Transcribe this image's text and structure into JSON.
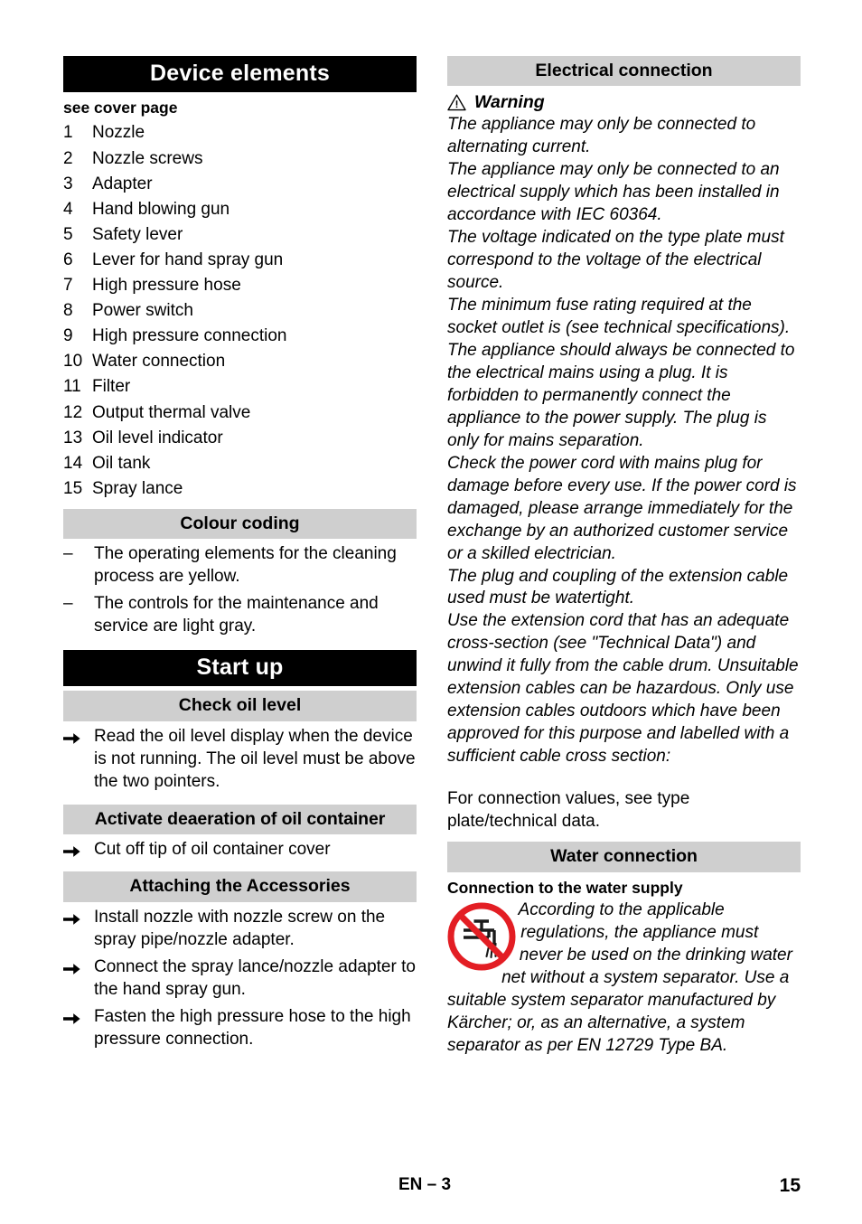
{
  "document": {
    "language_code": "EN",
    "footer_center": "EN – 3",
    "footer_page_number": "15"
  },
  "colors": {
    "heading_black_bg": "#000000",
    "heading_black_fg": "#ffffff",
    "heading_gray_bg": "#cfcfcf",
    "heading_gray_fg": "#000000",
    "prohibition_red": "#e31e24",
    "body_text": "#000000"
  },
  "left_column": {
    "device_elements": {
      "title": "Device elements",
      "lead": "see cover page",
      "items": [
        {
          "number": "1",
          "label": "Nozzle"
        },
        {
          "number": "2",
          "label": "Nozzle screws"
        },
        {
          "number": "3",
          "label": "Adapter"
        },
        {
          "number": "4",
          "label": "Hand blowing gun"
        },
        {
          "number": "5",
          "label": "Safety lever"
        },
        {
          "number": "6",
          "label": "Lever for hand spray gun"
        },
        {
          "number": "7",
          "label": "High pressure hose"
        },
        {
          "number": "8",
          "label": "Power switch"
        },
        {
          "number": "9",
          "label": "High pressure connection"
        },
        {
          "number": "10",
          "label": "Water connection"
        },
        {
          "number": "11",
          "label": "Filter"
        },
        {
          "number": "12",
          "label": "Output thermal valve"
        },
        {
          "number": "13",
          "label": "Oil level indicator"
        },
        {
          "number": "14",
          "label": "Oil tank"
        },
        {
          "number": "15",
          "label": "Spray lance"
        }
      ]
    },
    "colour_coding": {
      "title": "Colour coding",
      "bullet_mark": "–",
      "bullets": [
        "The operating elements for the cleaning process are yellow.",
        "The controls for the maintenance and service are light gray."
      ]
    },
    "start_up": {
      "title": "Start up"
    },
    "check_oil_level": {
      "title": "Check oil level",
      "steps": [
        "Read the oil level display when the device is not running. The oil level must be above the two pointers."
      ]
    },
    "activate_deaeration": {
      "title": "Activate deaeration of oil container",
      "steps": [
        "Cut off tip of oil container cover"
      ]
    },
    "attaching_accessories": {
      "title": "Attaching the Accessories",
      "steps": [
        "Install nozzle with nozzle screw on the spray pipe/nozzle adapter.",
        "Connect the spray lance/nozzle adapter to the hand spray gun.",
        "Fasten the high pressure hose to the high pressure connection."
      ]
    }
  },
  "right_column": {
    "electrical_connection": {
      "title": "Electrical connection",
      "warning_label": "Warning",
      "warning_icon": "warning-triangle-icon",
      "paragraphs": [
        "The appliance may only be connected to alternating current.",
        "The appliance may only be connected to an electrical supply which has been installed in accordance with IEC 60364.",
        "The voltage indicated on the type plate must correspond to the voltage of the electrical source.",
        "The minimum fuse rating required at the socket outlet is (see technical specifications).",
        "The appliance should always be connected to the electrical mains using a plug. It is forbidden to permanently connect the appliance to the power supply. The plug is only for mains separation.",
        "Check the power cord with mains plug for damage before every use. If the power cord is damaged, please arrange immediately for the exchange by an authorized customer service or a skilled electrician.",
        "The plug and coupling of the extension cable used must be watertight.",
        "Use the extension cord that has an adequate cross-section (see \"Technical Data\") and unwind it fully from the cable drum. Unsuitable extension cables can be hazardous. Only use extension cables outdoors which have been approved for this purpose and labelled with a sufficient cable cross section:"
      ],
      "closing_note": "For connection values, see type plate/technical data."
    },
    "water_connection": {
      "title": "Water connection",
      "subheading": "Connection to the water supply",
      "prohibition_icon": "no-drinking-water-icon",
      "body": "According to the applicable regulations, the appliance must never be used on the drinking water net without a system separator. Use a suitable system separator manufactured by Kärcher; or, as an alternative, a system separator as per EN 12729 Type BA."
    }
  }
}
